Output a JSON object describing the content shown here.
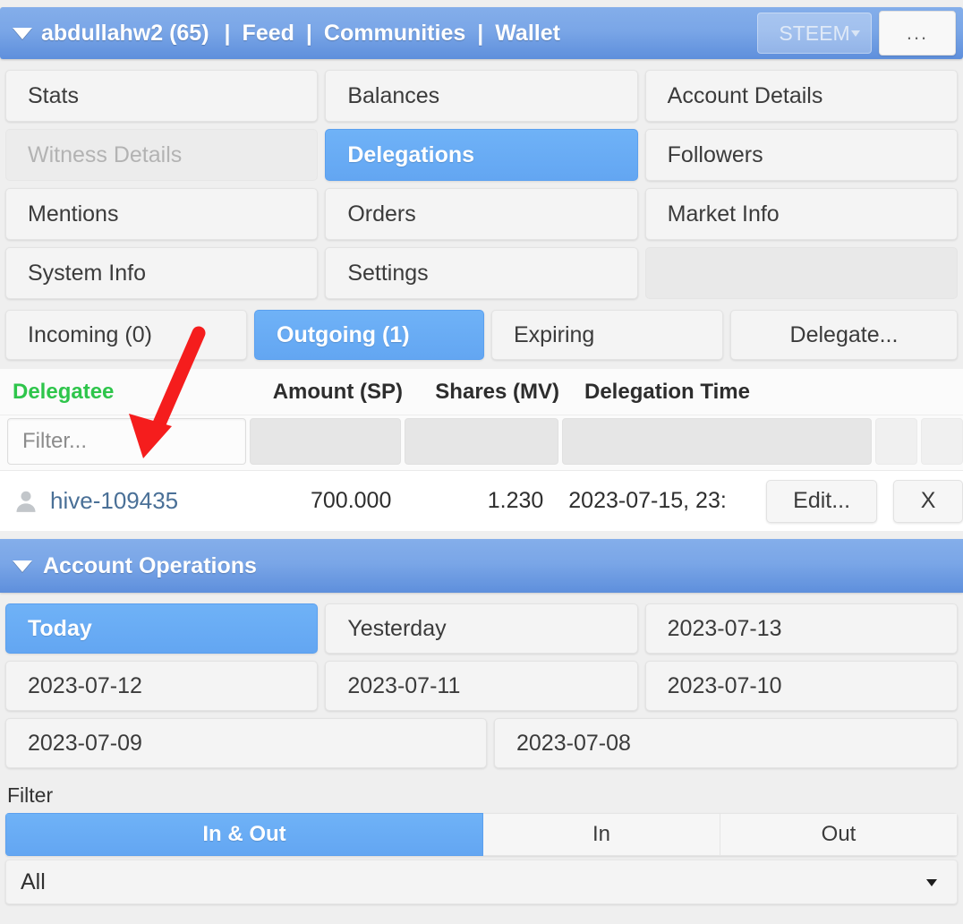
{
  "header": {
    "caret_icon": "caret-down-icon",
    "account": "abdullahw2 (65)",
    "sep": "|",
    "link_feed": "Feed",
    "link_communities": "Communities",
    "link_wallet": "Wallet",
    "currency_selected": "STEEM",
    "more_label": "...",
    "bg_gradient_top": "#84aeea",
    "bg_gradient_bottom": "#5e8fdc"
  },
  "nav_grid": {
    "rows": [
      [
        {
          "label": "Stats",
          "state": "normal"
        },
        {
          "label": "Balances",
          "state": "normal"
        },
        {
          "label": "Account Details",
          "state": "normal"
        }
      ],
      [
        {
          "label": "Witness Details",
          "state": "disabled"
        },
        {
          "label": "Delegations",
          "state": "active"
        },
        {
          "label": "Followers",
          "state": "normal"
        }
      ],
      [
        {
          "label": "Mentions",
          "state": "normal"
        },
        {
          "label": "Orders",
          "state": "normal"
        },
        {
          "label": "Market Info",
          "state": "normal"
        }
      ],
      [
        {
          "label": "System Info",
          "state": "normal"
        },
        {
          "label": "Settings",
          "state": "normal"
        },
        {
          "label": "",
          "state": "empty"
        }
      ]
    ],
    "active_color": "#63a6f2",
    "disabled_text_color": "#b3b3b3"
  },
  "delegation_tabs": {
    "incoming": "Incoming (0)",
    "outgoing": "Outgoing (1)",
    "expiring": "Expiring",
    "delegate": "Delegate...",
    "selected": "Outgoing (1)"
  },
  "table": {
    "columns": [
      "Delegatee",
      "Amount (SP)",
      "Shares (MV)",
      "Delegation Time"
    ],
    "sorted_column": "Delegatee",
    "sorted_color": "#2ec54b",
    "filter_placeholder": "Filter...",
    "rows": [
      {
        "icon": "user-icon",
        "delegatee": "hive-109435",
        "amount_sp": "700.000",
        "shares_mv": "1.230",
        "delegation_time": "2023-07-15, 23:",
        "edit_label": "Edit...",
        "remove_label": "X"
      }
    ]
  },
  "account_operations": {
    "caret_icon": "caret-down-icon",
    "title": "Account Operations",
    "date_rows": [
      [
        {
          "label": "Today",
          "state": "active"
        },
        {
          "label": "Yesterday",
          "state": "normal"
        },
        {
          "label": "2023-07-13",
          "state": "normal"
        }
      ],
      [
        {
          "label": "2023-07-12",
          "state": "normal"
        },
        {
          "label": "2023-07-11",
          "state": "normal"
        },
        {
          "label": "2023-07-10",
          "state": "normal"
        }
      ],
      [
        {
          "label": "2023-07-09",
          "state": "normal"
        },
        {
          "label": "2023-07-08",
          "state": "normal"
        }
      ]
    ]
  },
  "bottom_filter": {
    "label": "Filter",
    "segments": [
      {
        "label": "In & Out",
        "state": "active"
      },
      {
        "label": "In",
        "state": "normal"
      },
      {
        "label": "Out",
        "state": "normal"
      }
    ],
    "select_value": "All",
    "select_caret_icon": "caret-down-icon"
  },
  "annotation": {
    "arrow_color": "#f51d1d",
    "arrow_name": "red-pointer-arrow",
    "points_to": "Filter..."
  }
}
